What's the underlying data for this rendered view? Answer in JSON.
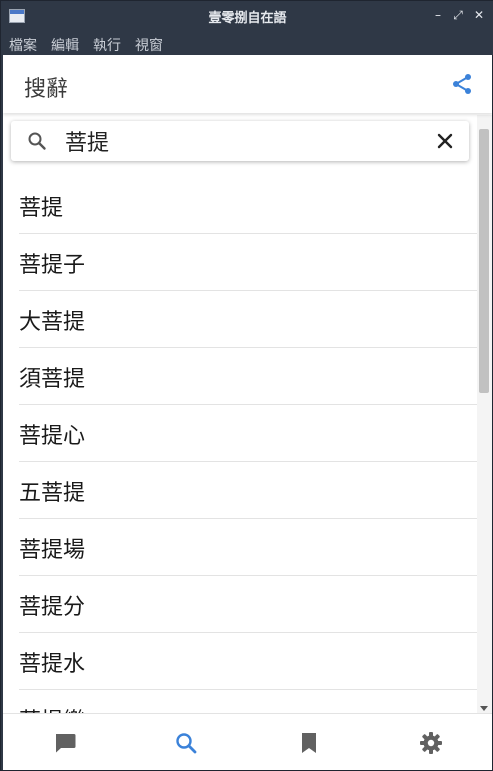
{
  "window": {
    "title": "壹零捌自在語",
    "controls": {
      "minimize": "–",
      "maximize": "⤢",
      "close": "✕"
    }
  },
  "menu": {
    "items": [
      "檔案",
      "編輯",
      "執行",
      "視窗"
    ]
  },
  "appbar": {
    "title": "搜辭",
    "share_icon": "share-icon"
  },
  "search": {
    "value": "菩提",
    "placeholder": ""
  },
  "results": [
    "菩提",
    "菩提子",
    "大菩提",
    "須菩提",
    "菩提心",
    "五菩提",
    "菩提場",
    "菩提分",
    "菩提水",
    "菩提樂"
  ],
  "bottom_nav": [
    {
      "icon": "chat-icon",
      "active": false
    },
    {
      "icon": "search-icon",
      "active": true
    },
    {
      "icon": "bookmark-icon",
      "active": false
    },
    {
      "icon": "settings-icon",
      "active": false
    }
  ],
  "colors": {
    "accent": "#3b82d9",
    "inactive_icon": "#616161",
    "titlebar": "#2f3846"
  }
}
